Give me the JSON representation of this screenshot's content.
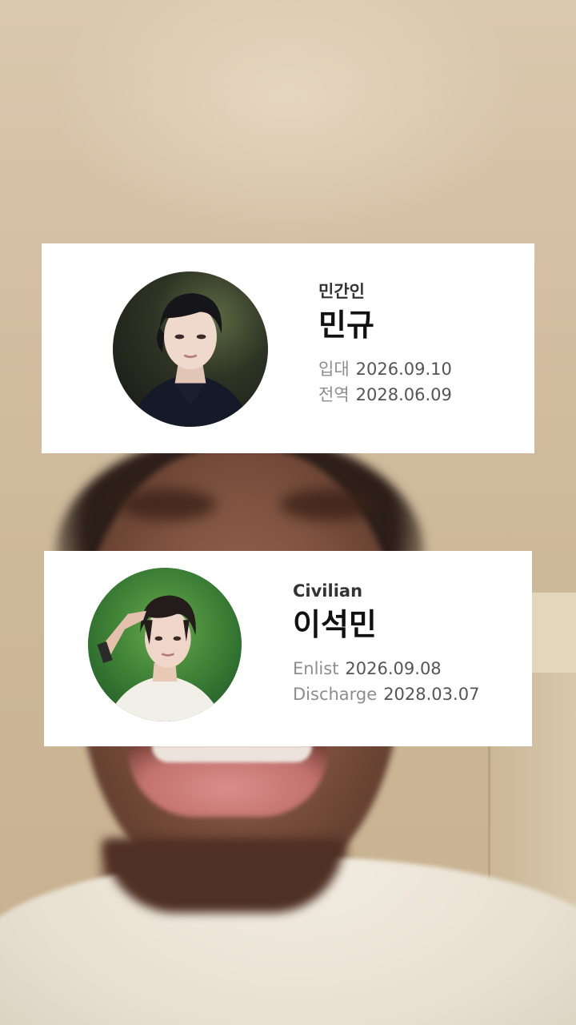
{
  "cards": [
    {
      "status": "민간인",
      "name": "민규",
      "dates": [
        {
          "label": "입대",
          "value": "2026.09.10"
        },
        {
          "label": "전역",
          "value": "2028.06.09"
        }
      ]
    },
    {
      "status": "Civilian",
      "name": "이석민",
      "dates": [
        {
          "label": "Enlist",
          "value": "2026.09.08"
        },
        {
          "label": "Discharge",
          "value": "2028.03.07"
        }
      ]
    }
  ]
}
